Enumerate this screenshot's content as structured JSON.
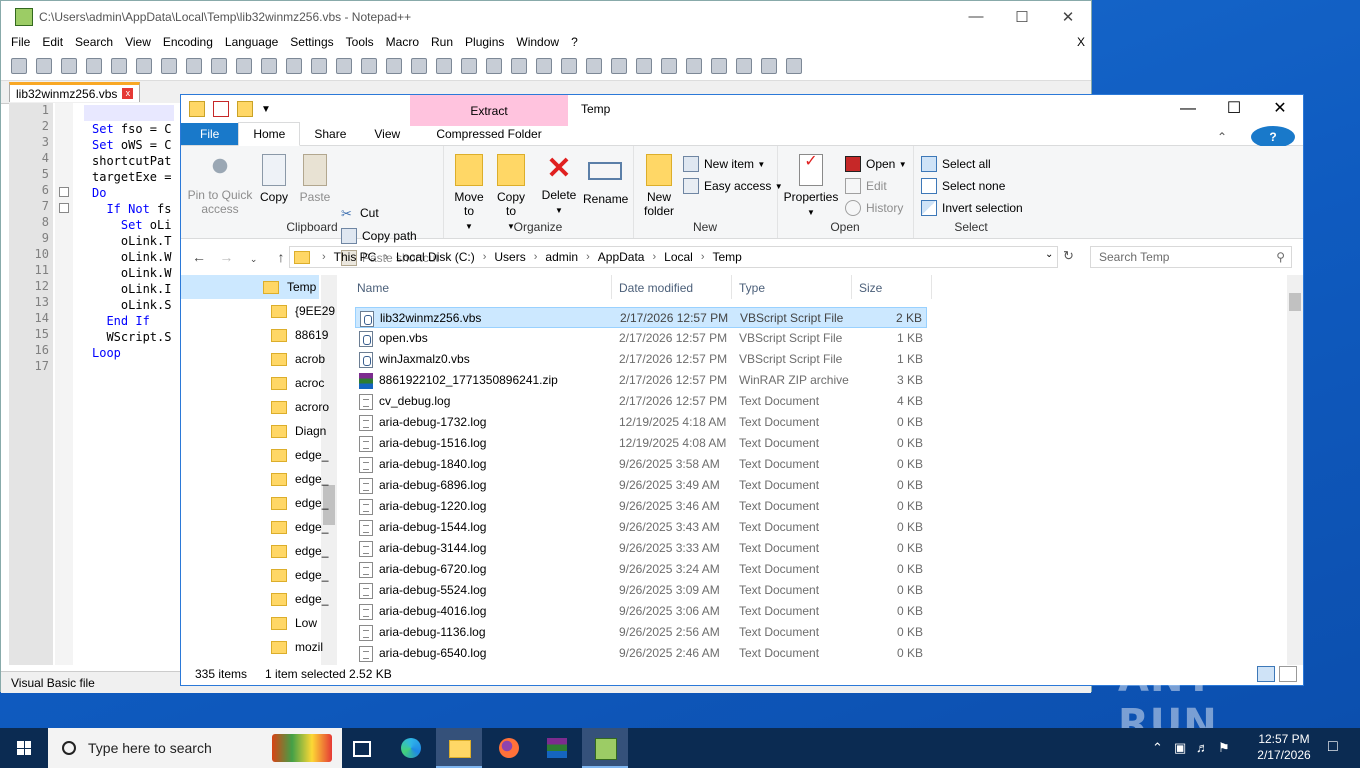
{
  "notepad": {
    "title": "C:\\Users\\admin\\AppData\\Local\\Temp\\lib32winmz256.vbs - Notepad++",
    "menu": [
      "File",
      "Edit",
      "Search",
      "View",
      "Encoding",
      "Language",
      "Settings",
      "Tools",
      "Macro",
      "Run",
      "Plugins",
      "Window",
      "?"
    ],
    "close_x": "X",
    "tab_label": "lib32winmz256.vbs",
    "line_numbers": [
      "1",
      "2",
      "3",
      "4",
      "5",
      "6",
      "7",
      "8",
      "9",
      "10",
      "11",
      "12",
      "13",
      "14",
      "15",
      "16",
      "17"
    ],
    "code_lines": [
      {
        "kw": "",
        "rest": ""
      },
      {
        "kw": "Set",
        "rest": " fso = C"
      },
      {
        "kw": "Set",
        "rest": " oWS = C"
      },
      {
        "kw": "",
        "rest": "shortcutPat"
      },
      {
        "kw": "",
        "rest": "targetExe ="
      },
      {
        "kw": "Do",
        "rest": ""
      },
      {
        "kw": "  If Not",
        "rest": " fs"
      },
      {
        "kw": "    Set",
        "rest": " oLi"
      },
      {
        "kw": "",
        "rest": "    oLink.T"
      },
      {
        "kw": "",
        "rest": "    oLink.W"
      },
      {
        "kw": "",
        "rest": "    oLink.W"
      },
      {
        "kw": "",
        "rest": "    oLink.I"
      },
      {
        "kw": "",
        "rest": "    oLink.S"
      },
      {
        "kw": "  End If",
        "rest": ""
      },
      {
        "kw": "",
        "rest": "  WScript.S"
      },
      {
        "kw": "Loop",
        "rest": ""
      },
      {
        "kw": "",
        "rest": ""
      }
    ],
    "status_left": "Visual Basic file"
  },
  "explorer": {
    "title": "Temp",
    "context_tab": "Extract",
    "tabs": {
      "file": "File",
      "home": "Home",
      "share": "Share",
      "view": "View",
      "compressed": "Compressed Folder Tools"
    },
    "ribbon": {
      "clipboard": {
        "label": "Clipboard",
        "pin": "Pin to Quick access",
        "copy": "Copy",
        "paste": "Paste",
        "cut": "Cut",
        "copy_path": "Copy path",
        "paste_shortcut": "Paste shortcut"
      },
      "organize": {
        "label": "Organize",
        "move_to": "Move to",
        "copy_to": "Copy to",
        "delete": "Delete",
        "rename": "Rename"
      },
      "new": {
        "label": "New",
        "new_folder": "New folder",
        "new_item": "New item",
        "easy_access": "Easy access"
      },
      "open": {
        "label": "Open",
        "properties": "Properties",
        "open": "Open",
        "edit": "Edit",
        "history": "History"
      },
      "select": {
        "label": "Select",
        "select_all": "Select all",
        "select_none": "Select none",
        "invert": "Invert selection"
      }
    },
    "address": [
      "This PC",
      "Local Disk (C:)",
      "Users",
      "admin",
      "AppData",
      "Local",
      "Temp"
    ],
    "search_placeholder": "Search Temp",
    "nav_items": [
      "Temp",
      "{9EE29",
      "88619",
      "acrob",
      "acroc",
      "acroro",
      "Diagn",
      "edge_",
      "edge_",
      "edge_",
      "edge_",
      "edge_",
      "edge_",
      "edge_",
      "Low",
      "mozil"
    ],
    "columns": {
      "name": "Name",
      "date": "Date modified",
      "type": "Type",
      "size": "Size"
    },
    "files": [
      {
        "name": "lib32winmz256.vbs",
        "date": "2/17/2026 12:57 PM",
        "type": "VBScript Script File",
        "size": "2 KB",
        "icon": "vbs",
        "selected": true
      },
      {
        "name": "open.vbs",
        "date": "2/17/2026 12:57 PM",
        "type": "VBScript Script File",
        "size": "1 KB",
        "icon": "vbs"
      },
      {
        "name": "winJaxmalz0.vbs",
        "date": "2/17/2026 12:57 PM",
        "type": "VBScript Script File",
        "size": "1 KB",
        "icon": "vbs"
      },
      {
        "name": "8861922102_1771350896241.zip",
        "date": "2/17/2026 12:57 PM",
        "type": "WinRAR ZIP archive",
        "size": "3 KB",
        "icon": "zip"
      },
      {
        "name": "cv_debug.log",
        "date": "2/17/2026 12:57 PM",
        "type": "Text Document",
        "size": "4 KB",
        "icon": "txt"
      },
      {
        "name": "aria-debug-1732.log",
        "date": "12/19/2025 4:18 AM",
        "type": "Text Document",
        "size": "0 KB",
        "icon": "txt"
      },
      {
        "name": "aria-debug-1516.log",
        "date": "12/19/2025 4:08 AM",
        "type": "Text Document",
        "size": "0 KB",
        "icon": "txt"
      },
      {
        "name": "aria-debug-1840.log",
        "date": "9/26/2025 3:58 AM",
        "type": "Text Document",
        "size": "0 KB",
        "icon": "txt"
      },
      {
        "name": "aria-debug-6896.log",
        "date": "9/26/2025 3:49 AM",
        "type": "Text Document",
        "size": "0 KB",
        "icon": "txt"
      },
      {
        "name": "aria-debug-1220.log",
        "date": "9/26/2025 3:46 AM",
        "type": "Text Document",
        "size": "0 KB",
        "icon": "txt"
      },
      {
        "name": "aria-debug-1544.log",
        "date": "9/26/2025 3:43 AM",
        "type": "Text Document",
        "size": "0 KB",
        "icon": "txt"
      },
      {
        "name": "aria-debug-3144.log",
        "date": "9/26/2025 3:33 AM",
        "type": "Text Document",
        "size": "0 KB",
        "icon": "txt"
      },
      {
        "name": "aria-debug-6720.log",
        "date": "9/26/2025 3:24 AM",
        "type": "Text Document",
        "size": "0 KB",
        "icon": "txt"
      },
      {
        "name": "aria-debug-5524.log",
        "date": "9/26/2025 3:09 AM",
        "type": "Text Document",
        "size": "0 KB",
        "icon": "txt"
      },
      {
        "name": "aria-debug-4016.log",
        "date": "9/26/2025 3:06 AM",
        "type": "Text Document",
        "size": "0 KB",
        "icon": "txt"
      },
      {
        "name": "aria-debug-1136.log",
        "date": "9/26/2025 2:56 AM",
        "type": "Text Document",
        "size": "0 KB",
        "icon": "txt"
      },
      {
        "name": "aria-debug-6540.log",
        "date": "9/26/2025 2:46 AM",
        "type": "Text Document",
        "size": "0 KB",
        "icon": "txt"
      }
    ],
    "status": {
      "items": "335 items",
      "selected": "1 item selected  2.52 KB"
    }
  },
  "taskbar": {
    "search_placeholder": "Type here to search",
    "time": "12:57 PM",
    "date": "2/17/2026"
  },
  "watermark": "ANY RUN"
}
